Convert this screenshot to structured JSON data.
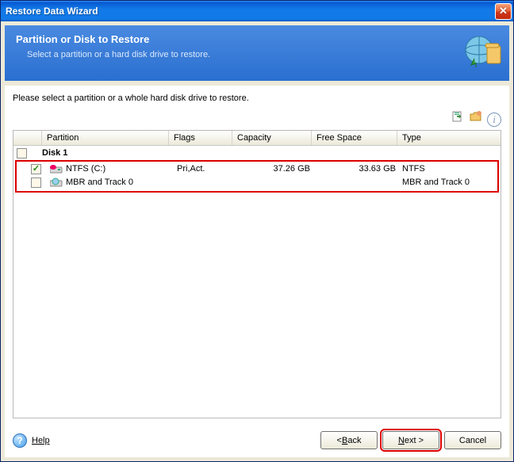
{
  "window": {
    "title": "Restore Data Wizard"
  },
  "header": {
    "title": "Partition or Disk to Restore",
    "subtitle": "Select a partition or a hard disk drive to restore."
  },
  "instruction": "Please select a partition or a whole hard disk drive to restore.",
  "columns": {
    "c0": "",
    "c1": "Partition",
    "c2": "Flags",
    "c3": "Capacity",
    "c4": "Free Space",
    "c5": "Type"
  },
  "disk": {
    "label": "Disk 1",
    "checked": false
  },
  "rows": [
    {
      "checked": true,
      "name": "NTFS (C:)",
      "flags": "Pri,Act.",
      "capacity": "37.26 GB",
      "free": "33.63 GB",
      "type": "NTFS",
      "icon": "drive-ntfs"
    },
    {
      "checked": false,
      "name": "MBR and Track 0",
      "flags": "",
      "capacity": "",
      "free": "",
      "type": "MBR and Track 0",
      "icon": "drive-mbr"
    }
  ],
  "footer": {
    "help": "Help",
    "back_prefix": "< ",
    "back_u": "B",
    "back_suffix": "ack",
    "next_u": "N",
    "next_suffix": "ext >",
    "cancel": "Cancel"
  }
}
